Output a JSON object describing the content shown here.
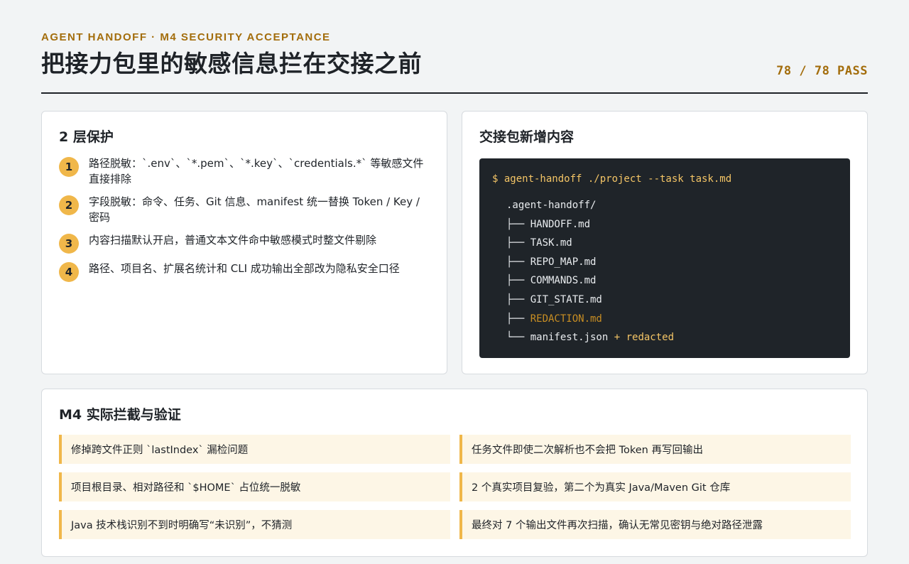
{
  "header": {
    "eyebrow": "AGENT HANDOFF · M4 SECURITY ACCEPTANCE",
    "title": "把接力包里的敏感信息拦在交接之前",
    "score": "78 / 78 PASS"
  },
  "layers": {
    "title": "2 层保护",
    "items": [
      {
        "num": "1",
        "text": "路径脱敏：`.env`、`*.pem`、`*.key`、`credentials.*` 等敏感文件直接排除"
      },
      {
        "num": "2",
        "text": "字段脱敏：命令、任务、Git 信息、manifest 统一替换 Token / Key / 密码"
      },
      {
        "num": "3",
        "text": "内容扫描默认开启，普通文本文件命中敏感模式时整文件剔除"
      },
      {
        "num": "4",
        "text": "路径、项目名、扩展名统计和 CLI 成功输出全部改为隐私安全口径"
      }
    ]
  },
  "package": {
    "title": "交接包新增内容",
    "command": "$ agent-handoff ./project --task task.md",
    "root": ".agent-handoff/",
    "files": [
      {
        "prefix": "├── ",
        "name": "HANDOFF.md"
      },
      {
        "prefix": "├── ",
        "name": "TASK.md"
      },
      {
        "prefix": "├── ",
        "name": "REPO_MAP.md"
      },
      {
        "prefix": "├── ",
        "name": "COMMANDS.md"
      },
      {
        "prefix": "├── ",
        "name": "GIT_STATE.md"
      },
      {
        "prefix": "├── ",
        "name": "REDACTION.md"
      },
      {
        "prefix": "└── ",
        "name": "manifest.json",
        "suffix": " + redacted"
      }
    ]
  },
  "verify": {
    "title": "M4 实际拦截与验证",
    "items": [
      "修掉跨文件正则 `lastIndex` 漏检问题",
      "任务文件即使二次解析也不会把 Token 再写回输出",
      "项目根目录、相对路径和 `$HOME` 占位统一脱敏",
      "2 个真实项目复验，第二个为真实 Java/Maven Git 仓库",
      "Java 技术栈识别不到时明确写“未识别”，不猜测",
      "最终对 7 个输出文件再次扫描，确认无常见密钥与绝对路径泄露"
    ]
  },
  "colors": {
    "accent": "#a36d0c",
    "badge": "#f0b74a",
    "terminal_bg": "#1f2429",
    "highlight_file": "#c88e23"
  }
}
